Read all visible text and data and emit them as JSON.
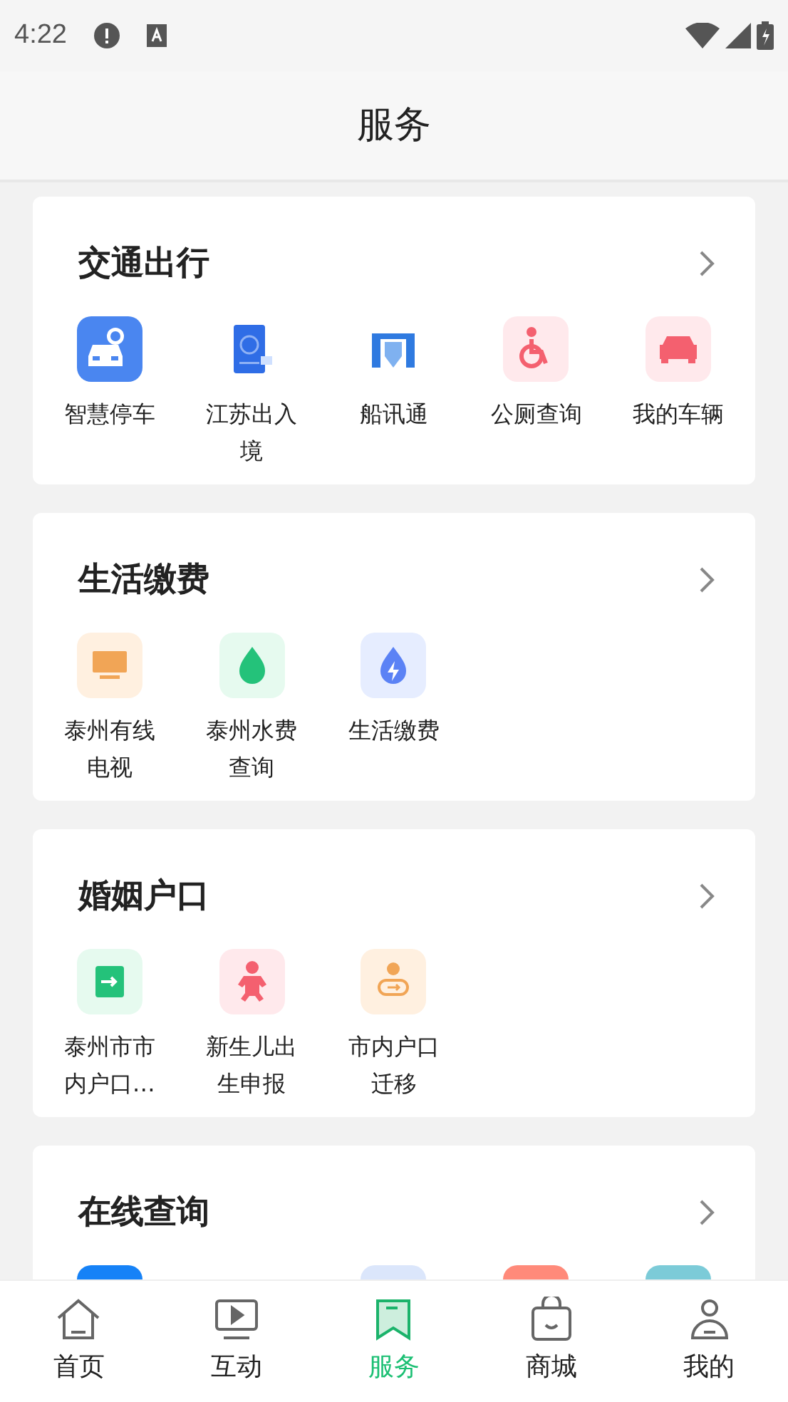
{
  "status_bar": {
    "time": "4:22"
  },
  "header": {
    "title": "服务"
  },
  "sections": [
    {
      "title": "交通出行",
      "items": [
        {
          "label": "智慧停车"
        },
        {
          "label": "江苏出入境"
        },
        {
          "label": "船讯通"
        },
        {
          "label": "公厕查询"
        },
        {
          "label": "我的车辆"
        }
      ]
    },
    {
      "title": "生活缴费",
      "items": [
        {
          "label": "泰州有线电视"
        },
        {
          "label": "泰州水费查询"
        },
        {
          "label": "生活缴费"
        }
      ]
    },
    {
      "title": "婚姻户口",
      "items": [
        {
          "label": "泰州市市内户口…"
        },
        {
          "label": "新生儿出生申报"
        },
        {
          "label": "市内户口迁移"
        }
      ]
    },
    {
      "title": "在线查询"
    }
  ],
  "tab_bar": [
    {
      "label": "首页",
      "selected": false
    },
    {
      "label": "互动",
      "selected": false
    },
    {
      "label": "服务",
      "selected": true
    },
    {
      "label": "商城",
      "selected": false
    },
    {
      "label": "我的",
      "selected": false
    }
  ]
}
